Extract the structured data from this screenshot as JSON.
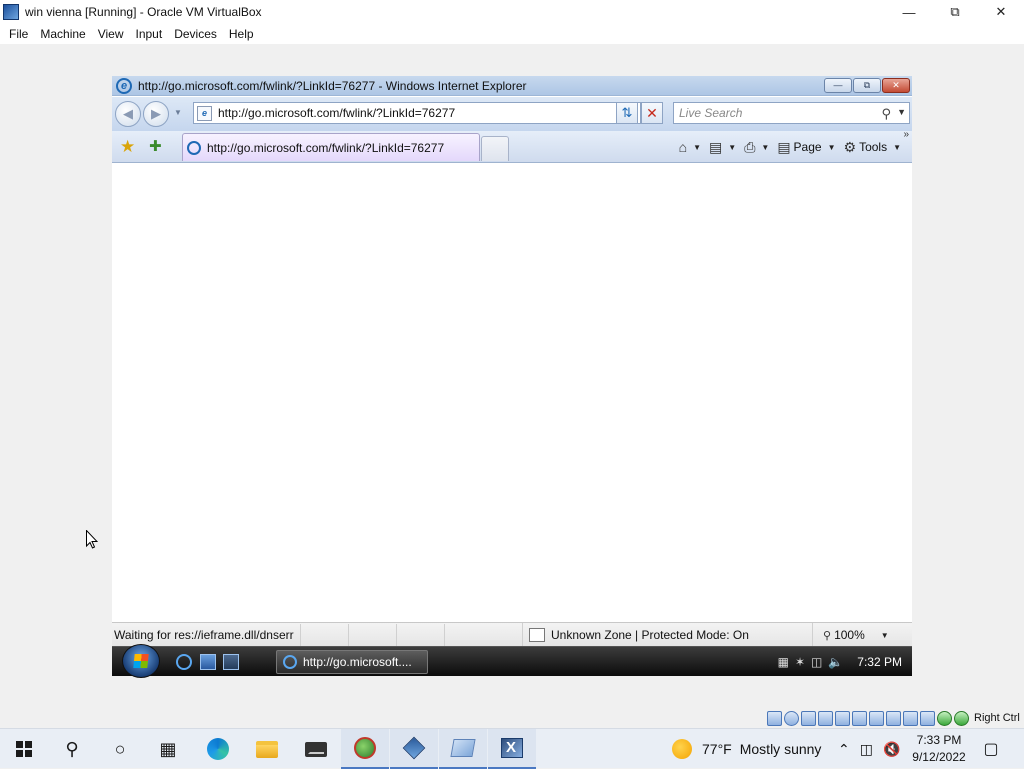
{
  "host": {
    "window_title": "win vienna [Running] - Oracle VM VirtualBox",
    "menu": [
      "File",
      "Machine",
      "View",
      "Input",
      "Devices",
      "Help"
    ],
    "host_key": "Right Ctrl"
  },
  "ie": {
    "window_title": "http://go.microsoft.com/fwlink/?LinkId=76277 - Windows Internet Explorer",
    "address": "http://go.microsoft.com/fwlink/?LinkId=76277",
    "search_placeholder": "Live Search",
    "tab_label": "http://go.microsoft.com/fwlink/?LinkId=76277",
    "commands": {
      "page": "Page",
      "tools": "Tools"
    },
    "status": {
      "text": "Waiting for res://ieframe.dll/dnserr",
      "zone": "Unknown Zone | Protected Mode: On",
      "zoom": "100%"
    }
  },
  "guest_taskbar": {
    "task_label": "http://go.microsoft....",
    "clock": "7:32 PM"
  },
  "host_taskbar": {
    "weather_temp": "77°F",
    "weather_desc": "Mostly sunny",
    "time": "7:33 PM",
    "date": "9/12/2022"
  },
  "colors": {
    "accent": "#4a78c2",
    "ie_title_gradient_top": "#c7d9ee",
    "guest_taskbar": "#1a1a1a"
  }
}
